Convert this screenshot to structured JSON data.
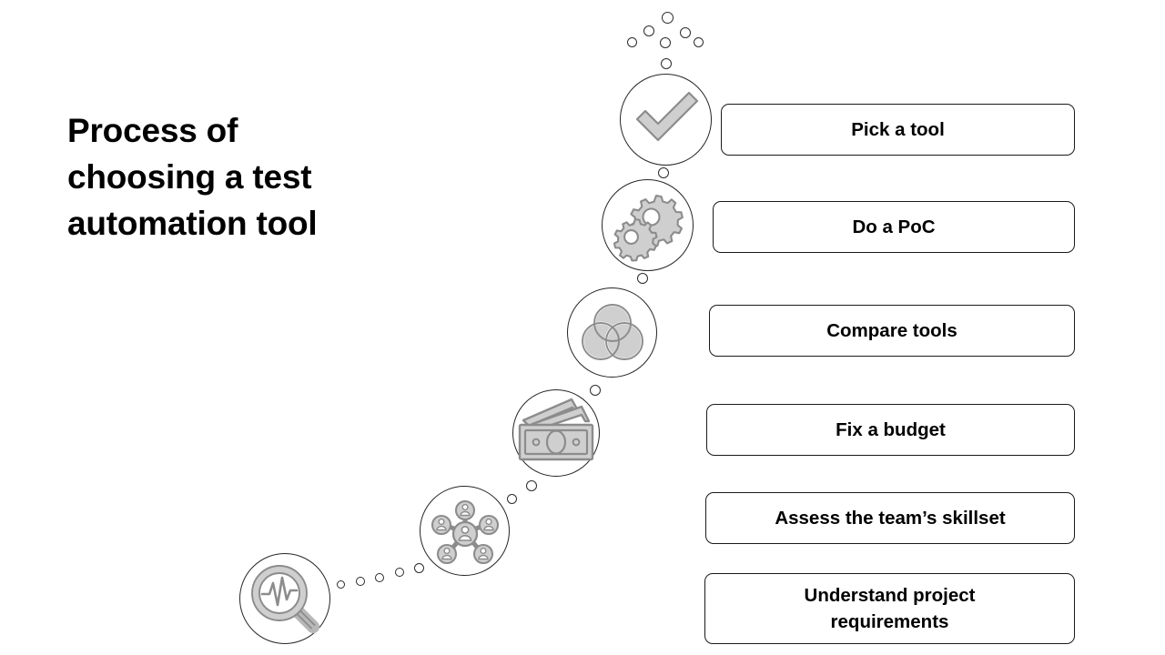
{
  "slide": {
    "background_color": "#ffffff",
    "title": "Process of\nchoosing a test\nautomation tool"
  },
  "theme": {
    "outline_color": "#262626",
    "icon_fill_gray": "#cfcfcf",
    "icon_stroke_gray": "#8c8c8c",
    "text_color": "#000000",
    "box_border_color": "#1a1a1a"
  },
  "steps": [
    {
      "id": "pick-a-tool",
      "label": "Pick a tool",
      "icon": "checkmark-icon",
      "order": 6
    },
    {
      "id": "do-a-poc",
      "label": "Do a PoC",
      "icon": "gears-icon",
      "order": 5
    },
    {
      "id": "compare-tools",
      "label": "Compare tools",
      "icon": "venn-diagram-icon",
      "order": 4
    },
    {
      "id": "fix-a-budget",
      "label": "Fix a budget",
      "icon": "banknotes-icon",
      "order": 3
    },
    {
      "id": "assess-skillset",
      "label": "Assess the team’s skillset",
      "icon": "team-network-icon",
      "order": 2
    },
    {
      "id": "understand-requirements",
      "label": "Understand project\nrequirements",
      "icon": "magnifier-pulse-icon",
      "order": 1
    }
  ]
}
